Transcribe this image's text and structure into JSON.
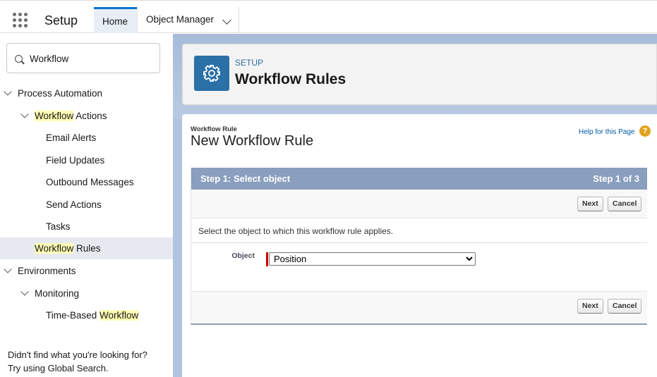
{
  "topbar": {
    "app_name": "Setup",
    "tabs": [
      {
        "label": "Home"
      },
      {
        "label": "Object Manager"
      }
    ]
  },
  "sidebar": {
    "search_value": "Workflow",
    "items": {
      "process_automation": "Process Automation",
      "workflow_actions_hl": "Workflow",
      "workflow_actions_rest": " Actions",
      "email_alerts": "Email Alerts",
      "field_updates": "Field Updates",
      "outbound_messages": "Outbound Messages",
      "send_actions": "Send Actions",
      "tasks": "Tasks",
      "workflow_rules_hl": "Workflow",
      "workflow_rules_rest": " Rules",
      "environments": "Environments",
      "monitoring": "Monitoring",
      "time_based_prefix": "Time-Based ",
      "time_based_hl": "Workflow"
    },
    "footer_line1": "Didn't find what you're looking for?",
    "footer_line2": "Try using Global Search."
  },
  "header": {
    "eyebrow": "SETUP",
    "title": "Workflow Rules",
    "icon": "gear-icon"
  },
  "form": {
    "breadcrumb": "Workflow Rule",
    "title": "New Workflow Rule",
    "help_link": "Help for this Page",
    "help_icon": "?",
    "step_title": "Step 1: Select object",
    "step_count": "Step 1 of 3",
    "next_label": "Next",
    "cancel_label": "Cancel",
    "instruction": "Select the object to which this workflow rule applies.",
    "object_label": "Object",
    "object_value": "Position"
  },
  "colors": {
    "accent": "#0176d3",
    "step_header": "#8a9ebe",
    "highlight": "#fdfdb4",
    "setup_icon_bg": "#2b70a7"
  }
}
